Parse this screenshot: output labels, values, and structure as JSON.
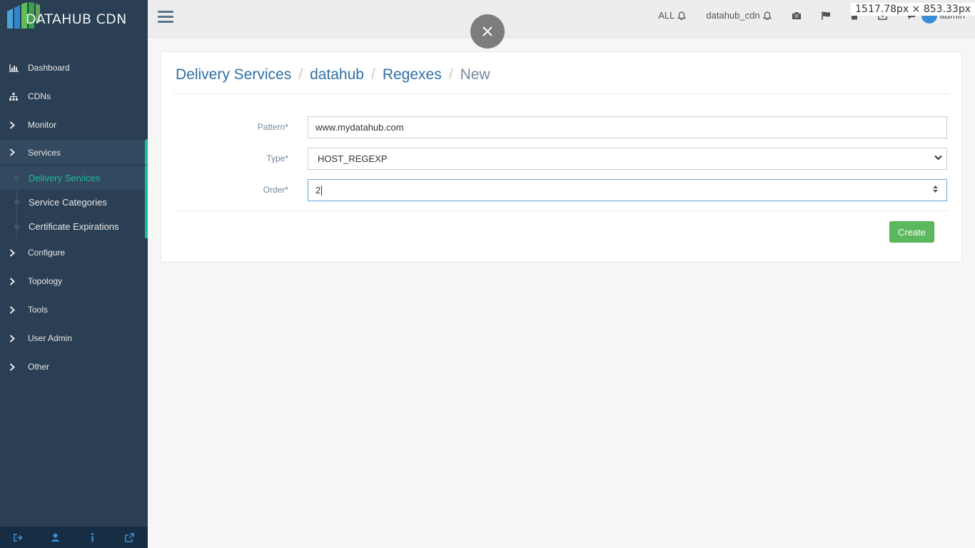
{
  "brand": {
    "name": "DATAHUB CDN"
  },
  "sidebar": {
    "items": [
      {
        "label": "Dashboard",
        "icon": "bar-chart-icon"
      },
      {
        "label": "CDNs",
        "icon": "sitemap-icon"
      },
      {
        "label": "Monitor",
        "icon": "chevron-right-icon"
      },
      {
        "label": "Services",
        "icon": "chevron-right-icon"
      },
      {
        "label": "Configure",
        "icon": "chevron-right-icon"
      },
      {
        "label": "Topology",
        "icon": "chevron-right-icon"
      },
      {
        "label": "Tools",
        "icon": "chevron-right-icon"
      },
      {
        "label": "User Admin",
        "icon": "chevron-right-icon"
      },
      {
        "label": "Other",
        "icon": "chevron-right-icon"
      }
    ],
    "services_sub": [
      {
        "label": "Delivery Services"
      },
      {
        "label": "Service Categories"
      },
      {
        "label": "Certificate Expirations"
      }
    ]
  },
  "topnav": {
    "all_label": "ALL",
    "cdn_label": "datahub_cdn",
    "user_label": "admin",
    "size_tooltip": "1517.78px × 853.33px"
  },
  "breadcrumb": {
    "items": [
      "Delivery Services",
      "datahub",
      "Regexes"
    ],
    "current": "New"
  },
  "form": {
    "pattern_label": "Pattern*",
    "pattern_value": "www.mydatahub.com",
    "type_label": "Type*",
    "type_value": "HOST_REGEXP",
    "order_label": "Order*",
    "order_value": "2",
    "create_label": "Create"
  },
  "colors": {
    "sidebar": "#2a3f54",
    "accent": "#1abb9c",
    "link": "#2f6fa8",
    "create": "#5cb85c"
  }
}
